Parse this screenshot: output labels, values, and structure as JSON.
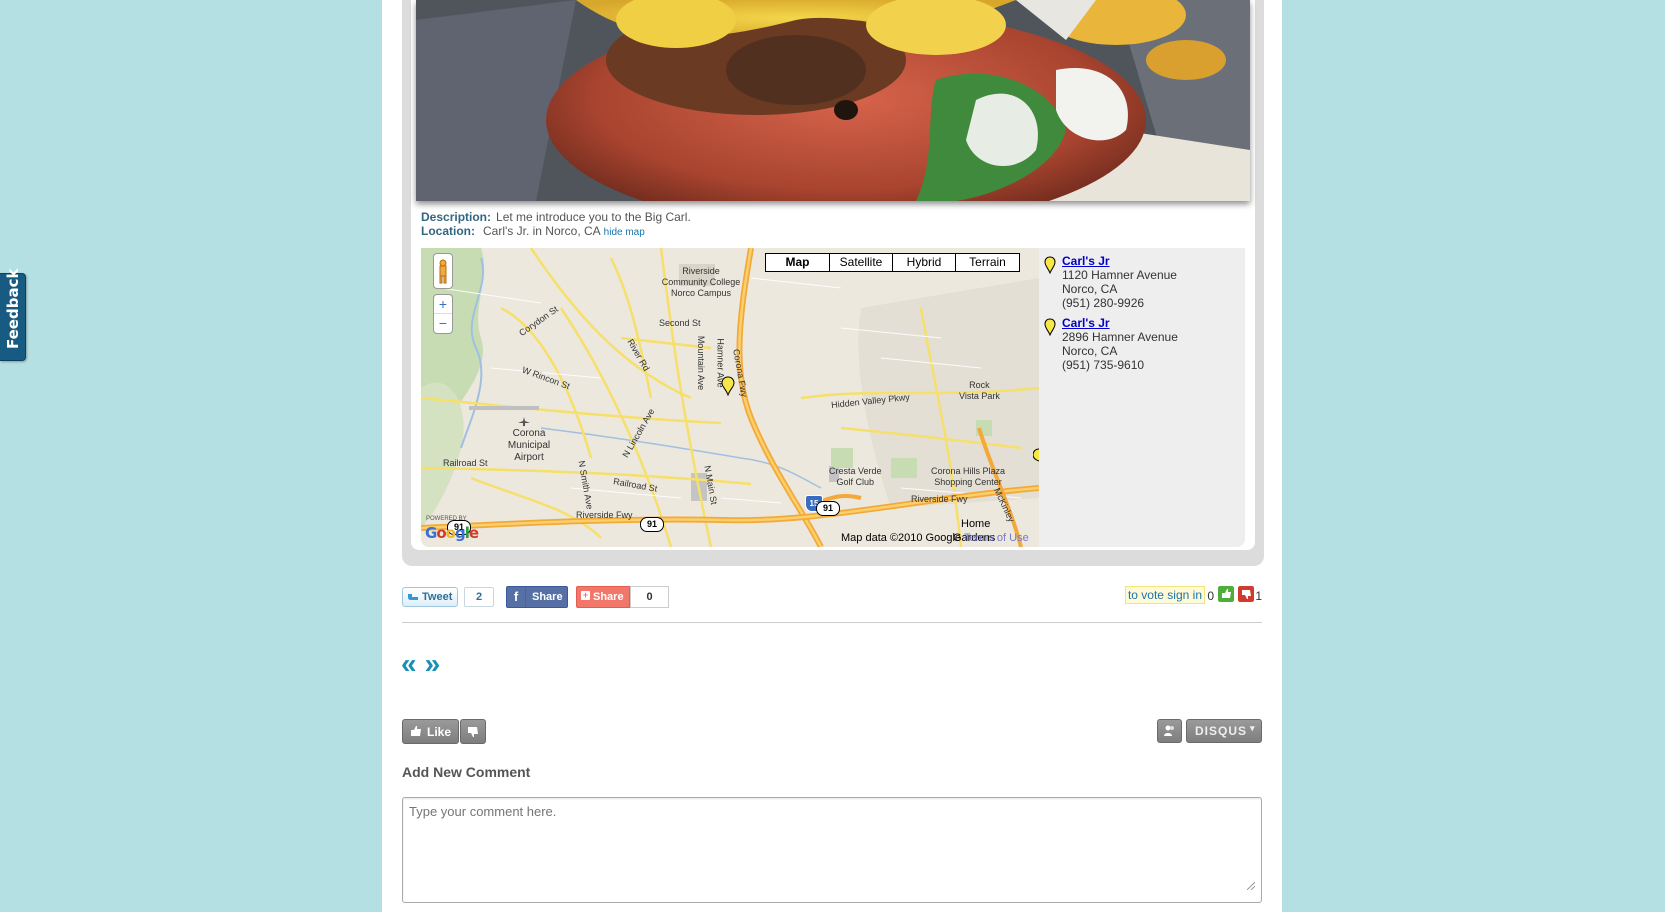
{
  "feedback": {
    "label": "Feedback"
  },
  "post": {
    "description_label": "Description:",
    "description": "Let me introduce you to the Big Carl.",
    "location_label": "Location:",
    "location": "Carl's Jr. in Norco, CA",
    "hide_map": "hide map"
  },
  "map": {
    "types": [
      "Map",
      "Satellite",
      "Hybrid",
      "Terrain"
    ],
    "active_type": "Map",
    "credit": "Map data ©2010 Google",
    "terms": "Terms of Use",
    "powered_by": "POWERED BY",
    "logo": "Google",
    "places": [
      {
        "label": "Riverside"
      },
      {
        "label": "Community College"
      },
      {
        "label": "Norco Campus"
      },
      {
        "label": "Second St"
      },
      {
        "label": "Corona"
      },
      {
        "label": "Municipal"
      },
      {
        "label": "Airport"
      },
      {
        "label": "Hidden Valley Pkwy"
      },
      {
        "label": "Rock"
      },
      {
        "label": "Vista Park"
      },
      {
        "label": "Cresta Verde"
      },
      {
        "label": "Golf Club"
      },
      {
        "label": "Corona Hills Plaza"
      },
      {
        "label": "Shopping Center"
      },
      {
        "label": "Riverside Fwy"
      },
      {
        "label": "Riverside Fwy"
      },
      {
        "label": "Railroad St"
      },
      {
        "label": "Railroad St"
      },
      {
        "label": "Home"
      },
      {
        "label": "Gardens"
      }
    ],
    "streets": [
      "Corydon St",
      "River Rd",
      "W Rincon St",
      "Mountain Ave",
      "Hamner Ave",
      "Corona Fwy",
      "N Lincoln Ave",
      "N Smith Ave",
      "N Main St",
      "McKinley"
    ],
    "shields": [
      "15",
      "91",
      "91",
      "91"
    ]
  },
  "listings": [
    {
      "name": "Carl's Jr",
      "address": "1120 Hamner Avenue",
      "city": "Norco, CA",
      "phone": "(951) 280-9926"
    },
    {
      "name": "Carl's Jr",
      "address": "2896 Hamner Avenue",
      "city": "Norco, CA",
      "phone": "(951) 735-9610"
    }
  ],
  "share": {
    "tweet_label": "Tweet",
    "tweet_count": "2",
    "fb_label": "Share",
    "gp_label": "Share",
    "gp_count": "0"
  },
  "vote": {
    "signin_text": "to vote sign in",
    "up_count": "0",
    "down_count": "1"
  },
  "nav": {
    "prev": "«",
    "next": "»"
  },
  "disqus": {
    "like_label": "Like",
    "brand": "DISQUS"
  },
  "comment": {
    "title": "Add New Comment",
    "placeholder": "Type your comment here."
  },
  "colors": {
    "background": "#b4e0e4",
    "accent": "#1a8fb6",
    "feedback_tab": "#175b82",
    "facebook": "#5670a6",
    "google_plus": "#f2776a"
  }
}
